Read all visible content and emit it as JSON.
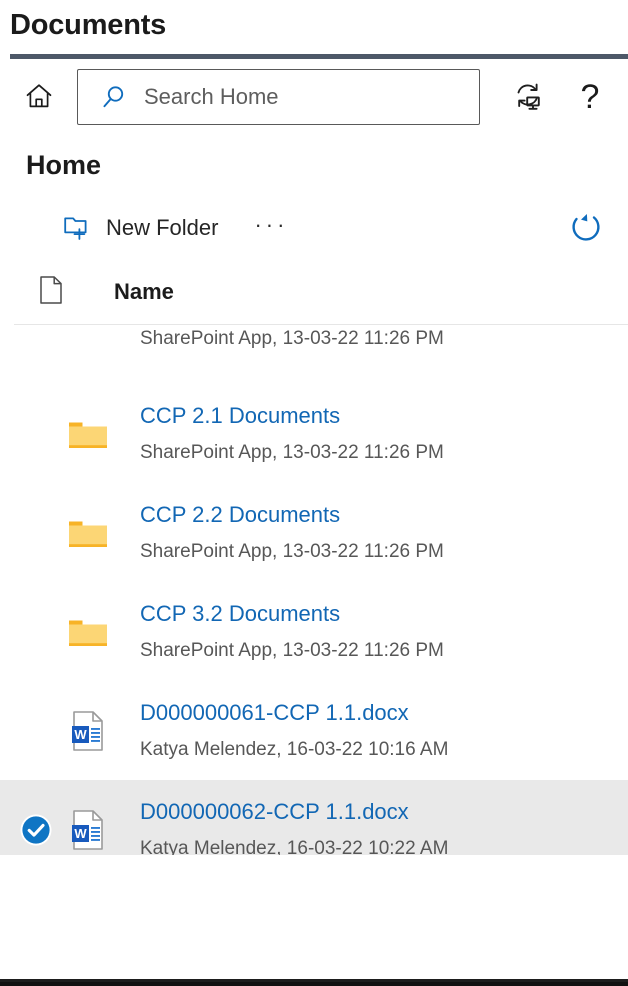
{
  "window": {
    "title": "Documents"
  },
  "commandbar": {
    "home_icon": "home-icon",
    "search": {
      "placeholder": "Search Home",
      "value": "",
      "icon": "search-icon"
    },
    "sync_icon": "sync-icon",
    "help_icon": "help-question-icon",
    "help_glyph": "?"
  },
  "page": {
    "heading": "Home"
  },
  "toolbar": {
    "new_folder_label": "New Folder",
    "new_folder_icon": "new-folder-icon",
    "more_label": "···",
    "refresh_icon": "refresh-icon"
  },
  "list": {
    "columns": {
      "icon_header": "file-type-icon",
      "name_header": "Name"
    },
    "rows": [
      {
        "title": "",
        "meta": "SharePoint App, 13-03-22 11:26 PM",
        "icon": "folder-icon",
        "selected": false,
        "clipped": true
      },
      {
        "title": "CCP 2.1 Documents",
        "meta": "SharePoint App, 13-03-22 11:26 PM",
        "icon": "folder-icon",
        "selected": false,
        "clipped": false
      },
      {
        "title": "CCP 2.2 Documents",
        "meta": "SharePoint App, 13-03-22 11:26 PM",
        "icon": "folder-icon",
        "selected": false,
        "clipped": false
      },
      {
        "title": "CCP 3.2 Documents",
        "meta": "SharePoint App, 13-03-22 11:26 PM",
        "icon": "folder-icon",
        "selected": false,
        "clipped": false
      },
      {
        "title": "D000000061-CCP 1.1.docx",
        "meta": "Katya Melendez, 16-03-22 10:16 AM",
        "icon": "word-document-icon",
        "selected": false,
        "clipped": false
      },
      {
        "title": "D000000062-CCP 1.1.docx",
        "meta": "Katya Melendez, 16-03-22 10:22 AM",
        "icon": "word-document-icon",
        "selected": true,
        "clipped": false
      }
    ]
  },
  "colors": {
    "title_rule": "#4d5868",
    "link_blue": "#1267b4",
    "accent_blue": "#0f6cbd",
    "folder_body": "#fcd675",
    "folder_tab": "#f7b327",
    "selected_row_bg": "#e9e9e9",
    "meta_text": "#575757"
  }
}
